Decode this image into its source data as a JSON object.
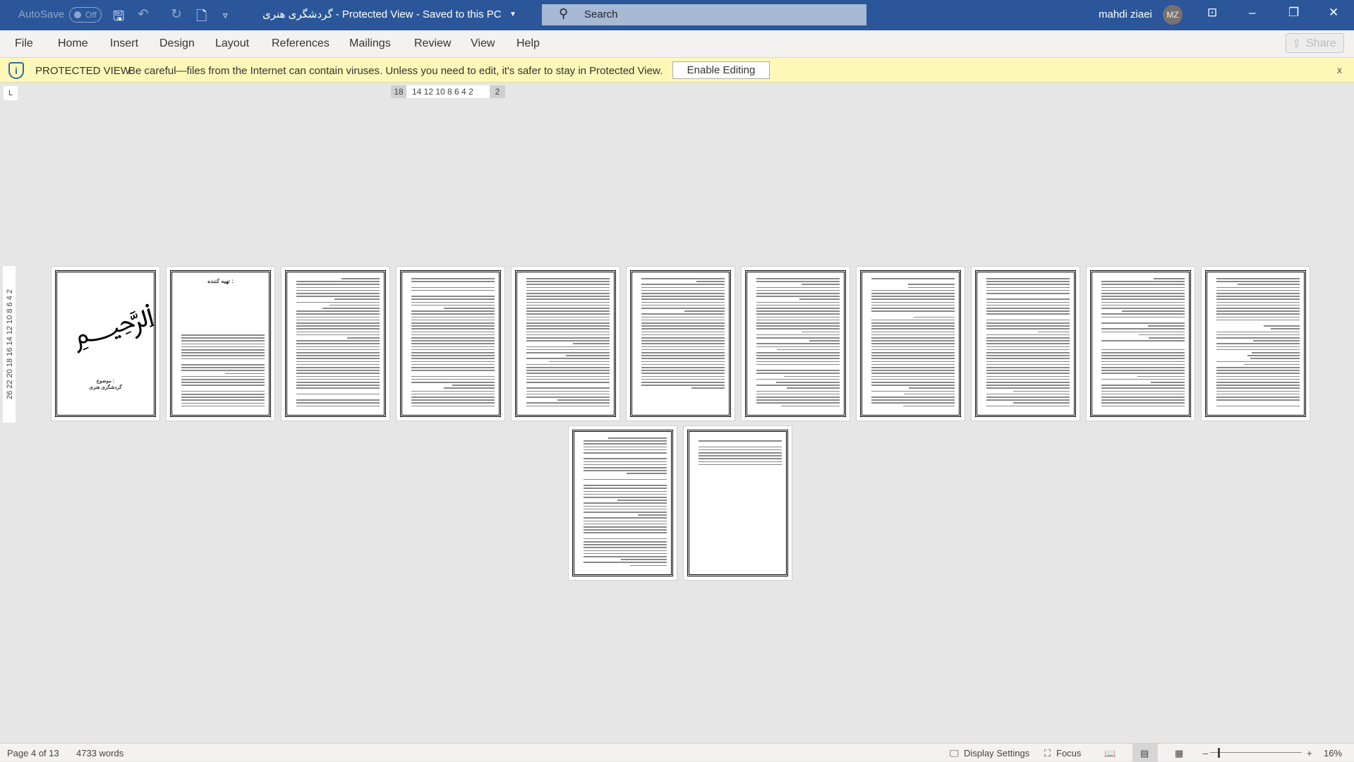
{
  "titlebar": {
    "autosave": "AutoSave",
    "autosave_state": "Off",
    "doc_title": "گردشگری هنری  -  Protected View  -  Saved to this PC",
    "search_placeholder": "Search",
    "user_name": "mahdi ziaei",
    "user_initials": "MZ"
  },
  "ribbon": {
    "tabs": [
      "File",
      "Home",
      "Insert",
      "Design",
      "Layout",
      "References",
      "Mailings",
      "Review",
      "View",
      "Help"
    ],
    "share": "Share"
  },
  "protected_view": {
    "label": "PROTECTED VIEW",
    "message": "Be careful—files from the Internet can contain viruses. Unless you need to edit, it's safer to stay in Protected View.",
    "button": "Enable Editing",
    "close": "x"
  },
  "ruler": {
    "left": "18",
    "middle": "14 12 10  8   6   4   2",
    "right": "2",
    "vertical": "26  22 20 18 16 14 12 10  8   6   4      2"
  },
  "pages": {
    "page1_subject": "موضوع :",
    "page1_title": "گردشگری هنری",
    "page2_heading": "تهیه کننده :",
    "count": 13
  },
  "status": {
    "page": "Page 4 of 13",
    "words": "4733 words",
    "display_settings": "Display Settings",
    "focus": "Focus",
    "zoom": "16%"
  }
}
